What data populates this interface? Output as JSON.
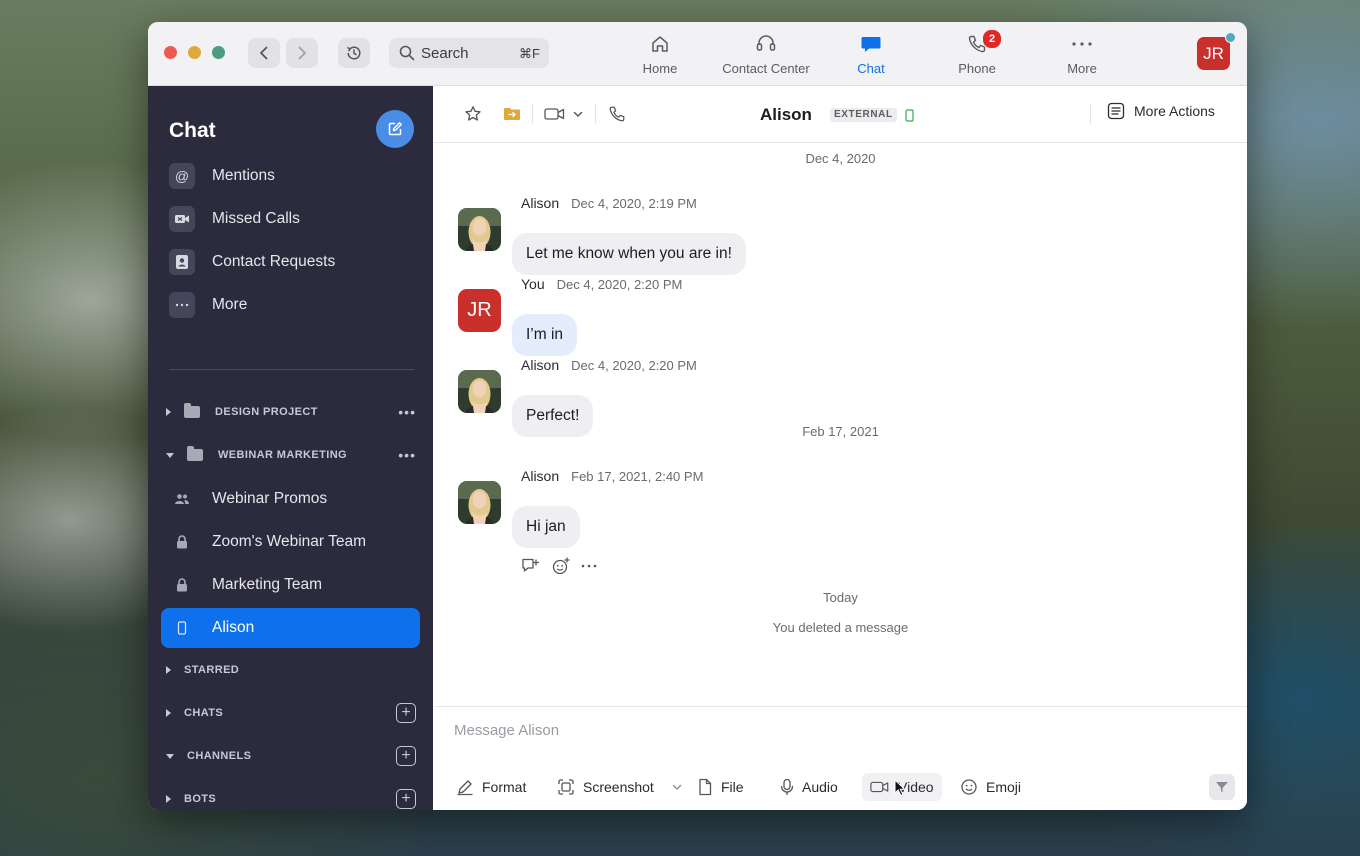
{
  "titlebar": {
    "search_label": "Search",
    "search_shortcut": "⌘F",
    "tabs": [
      {
        "label": "Home",
        "icon": "home-icon"
      },
      {
        "label": "Contact Center",
        "icon": "headset-icon"
      },
      {
        "label": "Chat",
        "icon": "chat-bubble-icon",
        "active": true
      },
      {
        "label": "Phone",
        "icon": "phone-icon",
        "badge": "2"
      },
      {
        "label": "More",
        "icon": "more-dots-icon"
      }
    ],
    "user_initials": "JR"
  },
  "sidebar": {
    "title": "Chat",
    "quick_items": [
      {
        "label": "Mentions",
        "icon": "at-icon"
      },
      {
        "label": "Missed Calls",
        "icon": "video-camera-icon"
      },
      {
        "label": "Contact Requests",
        "icon": "contact-card-icon"
      },
      {
        "label": "More",
        "icon": "more-dots-icon"
      }
    ],
    "folders": [
      {
        "label": "DESIGN PROJECT",
        "expanded": false
      },
      {
        "label": "WEBINAR MARKETING",
        "expanded": true
      }
    ],
    "folder_items": [
      {
        "label": "Webinar Promos",
        "icon": "people-icon"
      },
      {
        "label": "Zoom's Webinar Team",
        "icon": "lock-icon"
      },
      {
        "label": "Marketing Team",
        "icon": "lock-icon"
      },
      {
        "label": "Alison",
        "icon": "mobile-device-icon",
        "active": true
      }
    ],
    "sections": [
      "STARRED",
      "CHATS",
      "CHANNELS",
      "BOTS"
    ]
  },
  "chat_header": {
    "contact_name": "Alison",
    "external_badge": "EXTERNAL",
    "more_actions_label": "More Actions"
  },
  "messages": {
    "date_1": "Dec 4, 2020",
    "date_2": "Feb 17, 2021",
    "date_3": "Today",
    "items": [
      {
        "sender": "Alison",
        "time": "Dec 4, 2020, 2:19 PM",
        "text": "Let me know when you are in!"
      },
      {
        "sender": "You",
        "time": "Dec 4, 2020, 2:20 PM",
        "text": "I’m in",
        "initials": "JR"
      },
      {
        "sender": "Alison",
        "time": "Dec 4, 2020, 2:20 PM",
        "text": "Perfect!"
      },
      {
        "sender": "Alison",
        "time": "Feb 17, 2021, 2:40 PM",
        "text": "Hi jan"
      }
    ],
    "system_note": "You deleted a message"
  },
  "composer": {
    "placeholder": "Message Alison",
    "tools": [
      {
        "label": "Format",
        "icon": "format-pen-icon"
      },
      {
        "label": "Screenshot",
        "icon": "screenshot-icon"
      },
      {
        "label": "File",
        "icon": "file-icon"
      },
      {
        "label": "Audio",
        "icon": "microphone-icon"
      },
      {
        "label": "Video",
        "icon": "video-camera-icon"
      },
      {
        "label": "Emoji",
        "icon": "emoji-icon"
      }
    ]
  },
  "colors": {
    "accent": "#0e71eb",
    "sidebar_bg": "#2b2b3d",
    "avatar_red": "#c9302c",
    "badge_red": "#e02828"
  }
}
